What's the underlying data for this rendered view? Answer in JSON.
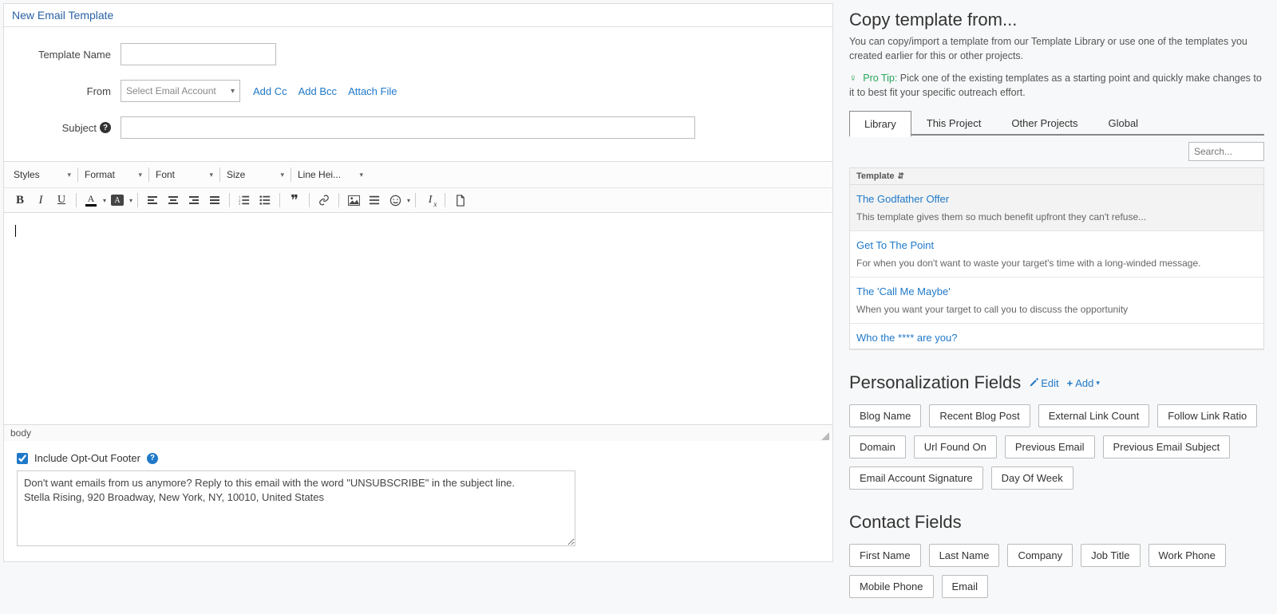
{
  "header": {
    "title": "New Email Template"
  },
  "form": {
    "template_name_label": "Template Name",
    "from_label": "From",
    "from_placeholder": "Select Email Account",
    "add_cc": "Add Cc",
    "add_bcc": "Add Bcc",
    "attach_file": "Attach File",
    "subject_label": "Subject"
  },
  "toolbar": {
    "dd": {
      "styles": "Styles",
      "format": "Format",
      "font": "Font",
      "size": "Size",
      "lineheight": "Line Hei..."
    }
  },
  "pathbar": "body",
  "footer": {
    "label": "Include Opt-Out Footer",
    "text": "Don't want emails from us anymore? Reply to this email with the word \"UNSUBSCRIBE\" in the subject line.\nStella Rising, 920 Broadway, New York, NY, 10010, United States"
  },
  "copy": {
    "title": "Copy template from...",
    "desc": "You can copy/import a template from our Template Library or use one of the templates you created earlier for this or other projects.",
    "protip_label": "Pro Tip:",
    "protip_text": "Pick one of the existing templates as a starting point and quickly make changes to it to best fit your specific outreach effort.",
    "tabs": [
      "Library",
      "This Project",
      "Other Projects",
      "Global"
    ],
    "search_placeholder": "Search...",
    "table_header": "Template",
    "rows": [
      {
        "title": "The Godfather Offer",
        "sub": "This template gives them so much benefit upfront they can't refuse..."
      },
      {
        "title": "Get To The Point",
        "sub": "For when you don't want to waste your target's time with a long-winded message."
      },
      {
        "title": "The 'Call Me Maybe'",
        "sub": "When you want your target to call you to discuss the opportunity"
      },
      {
        "title": "Who the **** are you?",
        "sub": ""
      }
    ]
  },
  "personalization": {
    "title": "Personalization Fields",
    "edit": "Edit",
    "add": "Add",
    "fields": [
      "Blog Name",
      "Recent Blog Post",
      "External Link Count",
      "Follow Link Ratio",
      "Domain",
      "Url Found On",
      "Previous Email",
      "Previous Email Subject",
      "Email Account Signature",
      "Day Of Week"
    ]
  },
  "contact": {
    "title": "Contact Fields",
    "fields": [
      "First Name",
      "Last Name",
      "Company",
      "Job Title",
      "Work Phone",
      "Mobile Phone",
      "Email"
    ]
  }
}
